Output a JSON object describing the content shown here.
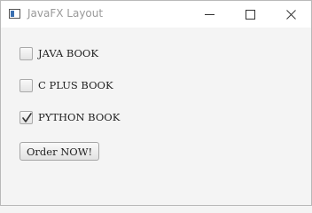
{
  "window": {
    "title": "JavaFX Layout"
  },
  "checkboxes": [
    {
      "label": "JAVA BOOK",
      "checked": false
    },
    {
      "label": "C PLUS BOOK",
      "checked": false
    },
    {
      "label": "PYTHON BOOK",
      "checked": true
    }
  ],
  "order_button": {
    "label": "Order NOW!"
  },
  "icons": {
    "app": "app-window-icon",
    "minimize": "minimize-icon",
    "maximize": "maximize-icon",
    "close": "close-icon",
    "check": "check-icon"
  }
}
